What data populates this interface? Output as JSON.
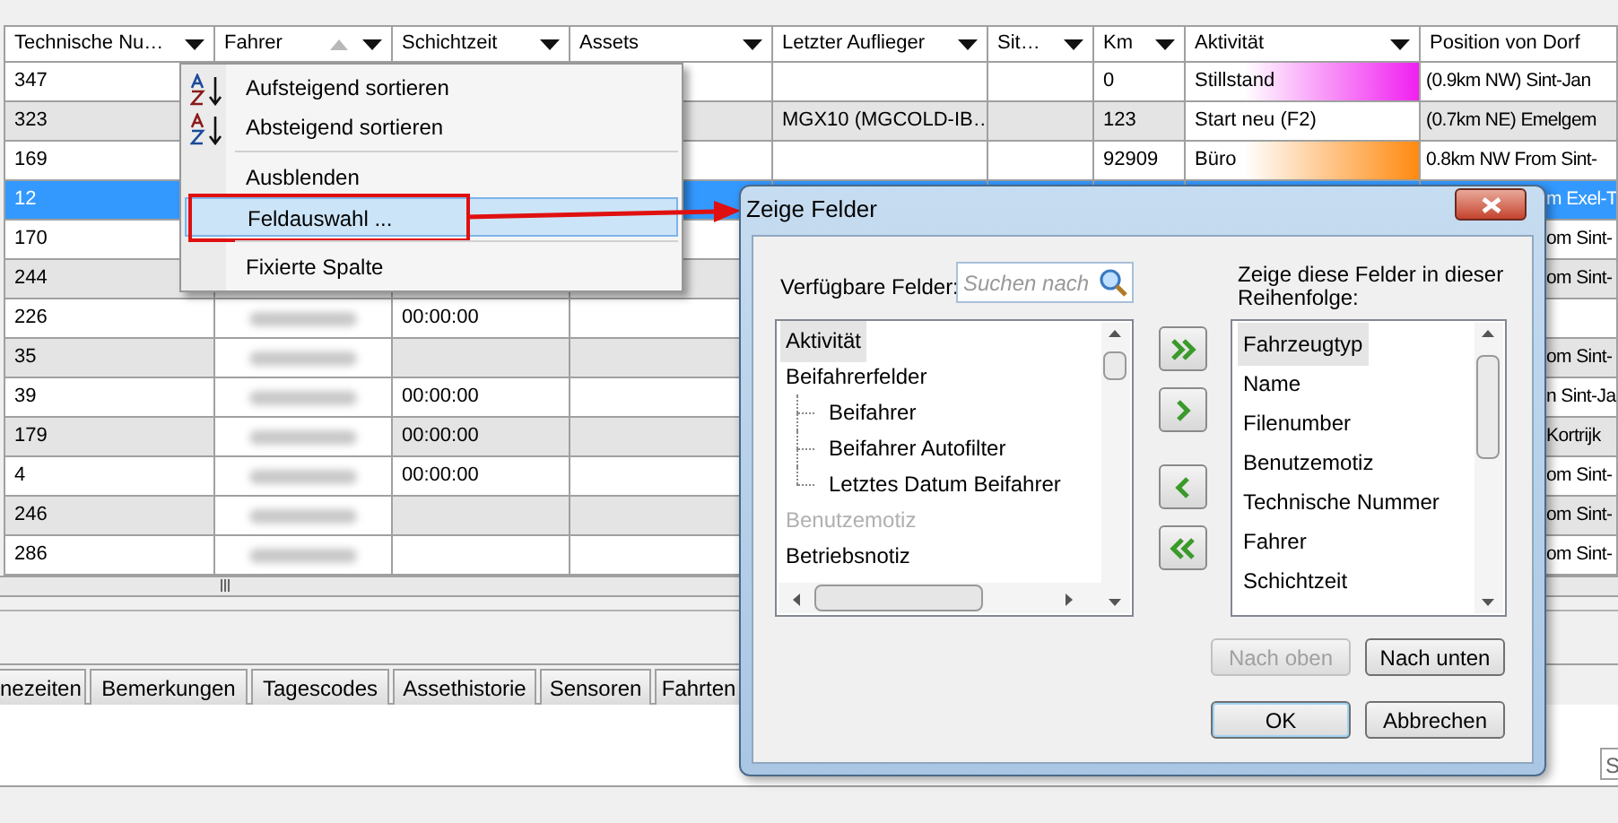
{
  "grid": {
    "columns": [
      {
        "label": "Technische Nu…",
        "sorted": false
      },
      {
        "label": "Fahrer",
        "sorted": true
      },
      {
        "label": "Schichtzeit",
        "sorted": false
      },
      {
        "label": "Assets",
        "sorted": false
      },
      {
        "label": "Letzter Auflieger",
        "sorted": false
      },
      {
        "label": "Sit…",
        "sorted": false
      },
      {
        "label": "Km",
        "sorted": false
      },
      {
        "label": "Aktivität",
        "sorted": false
      },
      {
        "label": "Position von Dorf",
        "sorted": false
      }
    ],
    "rows": [
      {
        "technische_nummer": "347",
        "km": "0",
        "aktivitaet": {
          "text": "Stillstand",
          "color": "#f020f0"
        },
        "position": "(0.9km NW) Sint-Jan",
        "selected": false
      },
      {
        "technische_nummer": "323",
        "letzter_auflieger": "MGX10 (MGCOLD-IB…",
        "km": "123",
        "aktivitaet": {
          "text": "Start neu (F2)"
        },
        "position": "(0.7km NE) Emelgem",
        "selected": false
      },
      {
        "technische_nummer": "169",
        "km": "92909",
        "aktivitaet": {
          "text": "Büro",
          "color": "#ff8a10"
        },
        "position": "0.8km NW From Sint-",
        "selected": false
      },
      {
        "technische_nummer": "12",
        "position": "m Exel-T",
        "selected": true
      },
      {
        "technische_nummer": "170",
        "position": "om Sint-",
        "selected": false
      },
      {
        "technische_nummer": "244",
        "position": "om Sint-",
        "selected": false
      },
      {
        "technische_nummer": "226",
        "schichtzeit": "00:00:00",
        "selected": false
      },
      {
        "technische_nummer": "35",
        "position": "om Sint-",
        "selected": false
      },
      {
        "technische_nummer": "39",
        "schichtzeit": "00:00:00",
        "position": "n Sint-Ja",
        "selected": false
      },
      {
        "technische_nummer": "179",
        "schichtzeit": "00:00:00",
        "position": "Kortrijk",
        "selected": false
      },
      {
        "technische_nummer": "4",
        "schichtzeit": "00:00:00",
        "position": "om Sint-",
        "selected": false
      },
      {
        "technische_nummer": "246",
        "position": "om Sint-",
        "selected": false
      },
      {
        "technische_nummer": "286",
        "position": "om Sint-",
        "selected": false
      }
    ]
  },
  "context_menu": {
    "items": [
      {
        "kind": "item",
        "label": "Aufsteigend sortieren",
        "selected": false
      },
      {
        "kind": "item",
        "label": "Absteigend sortieren",
        "selected": false
      },
      {
        "kind": "separator"
      },
      {
        "kind": "item",
        "label": "Ausblenden",
        "selected": false
      },
      {
        "kind": "item",
        "label": "Feldauswahl ...",
        "selected": true,
        "callout": true
      },
      {
        "kind": "separator"
      },
      {
        "kind": "item",
        "label": "Fixierte Spalte",
        "selected": false
      }
    ]
  },
  "tabs": [
    {
      "label": "nezeiten",
      "selected": false
    },
    {
      "label": "Bemerkungen",
      "selected": false
    },
    {
      "label": "Tagescodes",
      "selected": false
    },
    {
      "label": "Assethistorie",
      "selected": false
    },
    {
      "label": "Sensoren",
      "selected": false
    },
    {
      "label": "Fahrten",
      "selected": false
    }
  ],
  "corner_field": {
    "value": "S"
  },
  "dialog": {
    "title": "Zeige Felder",
    "available_label": "Verfügbare Felder:",
    "search": {
      "placeholder": "Suchen nach"
    },
    "shown_label": "Zeige diese Felder in dieser Reihenfolge:",
    "available_fields": [
      {
        "label": "Aktivität",
        "selected": true,
        "disabled": false
      },
      {
        "label": "Beifahrerfelder",
        "selected": false,
        "disabled": false,
        "children": [
          {
            "label": "Beifahrer",
            "selected": false,
            "disabled": false
          },
          {
            "label": "Beifahrer Autofilter",
            "selected": false,
            "disabled": false
          },
          {
            "label": "Letztes Datum Beifahrer",
            "selected": false,
            "disabled": false
          }
        ]
      },
      {
        "label": "Benutzemotiz",
        "selected": false,
        "disabled": true
      },
      {
        "label": "Betriebsnotiz",
        "selected": false,
        "disabled": false
      }
    ],
    "move_buttons": [
      {
        "kind": "add-all"
      },
      {
        "kind": "add"
      },
      {
        "kind": "remove"
      },
      {
        "kind": "remove-all"
      }
    ],
    "shown_fields": [
      {
        "label": "Fahrzeugtyp",
        "selected": true
      },
      {
        "label": "Name",
        "selected": false
      },
      {
        "label": "Filenumber",
        "selected": false
      },
      {
        "label": "Benutzemotiz",
        "selected": false
      },
      {
        "label": "Technische Nummer",
        "selected": false
      },
      {
        "label": "Fahrer",
        "selected": false
      },
      {
        "label": "Schichtzeit",
        "selected": false
      }
    ],
    "buttons": [
      {
        "label": "Nach oben",
        "disabled": true,
        "default": false
      },
      {
        "label": "Nach unten",
        "disabled": false,
        "default": false
      },
      {
        "label": "OK",
        "disabled": false,
        "default": true
      },
      {
        "label": "Abbrechen",
        "disabled": false,
        "default": false
      }
    ]
  }
}
